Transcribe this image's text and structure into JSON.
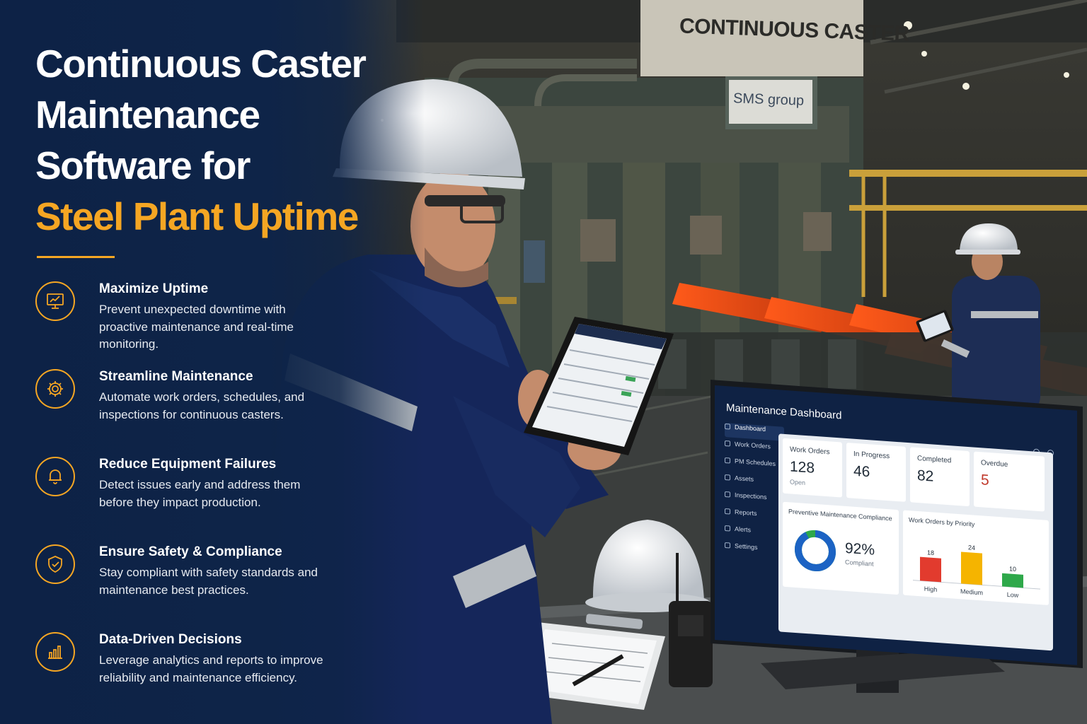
{
  "headline": {
    "line1": "Continuous Caster",
    "line2": "Maintenance",
    "line3": "Software for",
    "line4": "Steel Plant Uptime"
  },
  "features": [
    {
      "icon": "monitor-chart-icon",
      "title": "Maximize Uptime",
      "description": "Prevent unexpected downtime with proactive maintenance and real-time monitoring."
    },
    {
      "icon": "gear-icon",
      "title": "Streamline Maintenance",
      "description": "Automate work orders, schedules, and inspections for continuous casters."
    },
    {
      "icon": "bell-icon",
      "title": "Reduce Equipment Failures",
      "description": "Detect issues early and address them before they impact production."
    },
    {
      "icon": "shield-check-icon",
      "title": "Ensure Safety & Compliance",
      "description": "Stay compliant with safety standards and maintenance best practices."
    },
    {
      "icon": "bar-chart-icon",
      "title": "Data-Driven Decisions",
      "description": "Leverage analytics and reports to improve reliability and maintenance efficiency."
    }
  ],
  "scene": {
    "sign_main": "CONTINUOUS CASTER",
    "sign_brand": "SMS group"
  },
  "dashboard": {
    "title": "Maintenance Dashboard",
    "nav": [
      "Dashboard",
      "Work Orders",
      "PM Schedules",
      "Assets",
      "Inspections",
      "Reports",
      "Alerts",
      "Settings"
    ],
    "kpis": [
      {
        "label": "Work Orders",
        "value": "128",
        "sub": "Open"
      },
      {
        "label": "In Progress",
        "value": "46",
        "sub": ""
      },
      {
        "label": "Completed",
        "value": "82",
        "sub": ""
      },
      {
        "label": "Overdue",
        "value": "5",
        "sub": ""
      }
    ],
    "compliance": {
      "title": "Preventive Maintenance Compliance",
      "value_text": "92%",
      "value": 92,
      "sub": "Compliant"
    },
    "priority": {
      "title": "Work Orders by Priority"
    }
  },
  "chart_data": {
    "type": "bar",
    "title": "Work Orders by Priority",
    "categories": [
      "High",
      "Medium",
      "Low"
    ],
    "values": [
      18,
      24,
      10
    ],
    "colors": [
      "#e23b2e",
      "#f5b400",
      "#2ea84a"
    ]
  },
  "colors": {
    "navy": "#0d2246",
    "accent": "#f5a623"
  }
}
